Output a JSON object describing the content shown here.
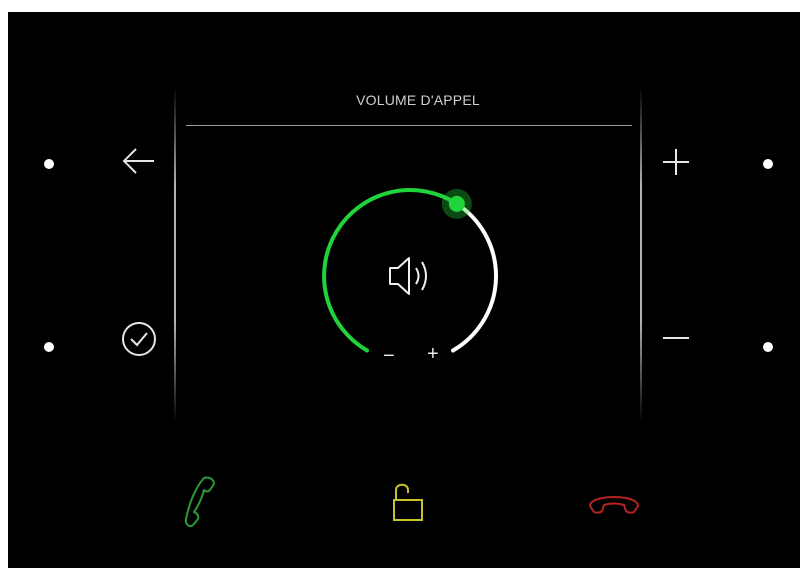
{
  "header": {
    "title": "VOLUME D'APPEL"
  },
  "volume": {
    "level": 0.61,
    "minus_label": "−",
    "plus_label": "+",
    "active_color": "#21d33a",
    "inactive_color": "#ffffff"
  },
  "icons": {
    "back": "arrow-left-icon",
    "confirm": "check-circle-icon",
    "increase": "plus-icon",
    "decrease": "minus-icon",
    "speaker": "speaker-icon",
    "answer": "phone-answer-icon",
    "unlock": "unlock-icon",
    "hangup": "phone-hangup-icon"
  },
  "colors": {
    "background": "#000000",
    "answer": "#2a9b3a",
    "unlock": "#c9c12a",
    "hangup": "#b3231f"
  }
}
